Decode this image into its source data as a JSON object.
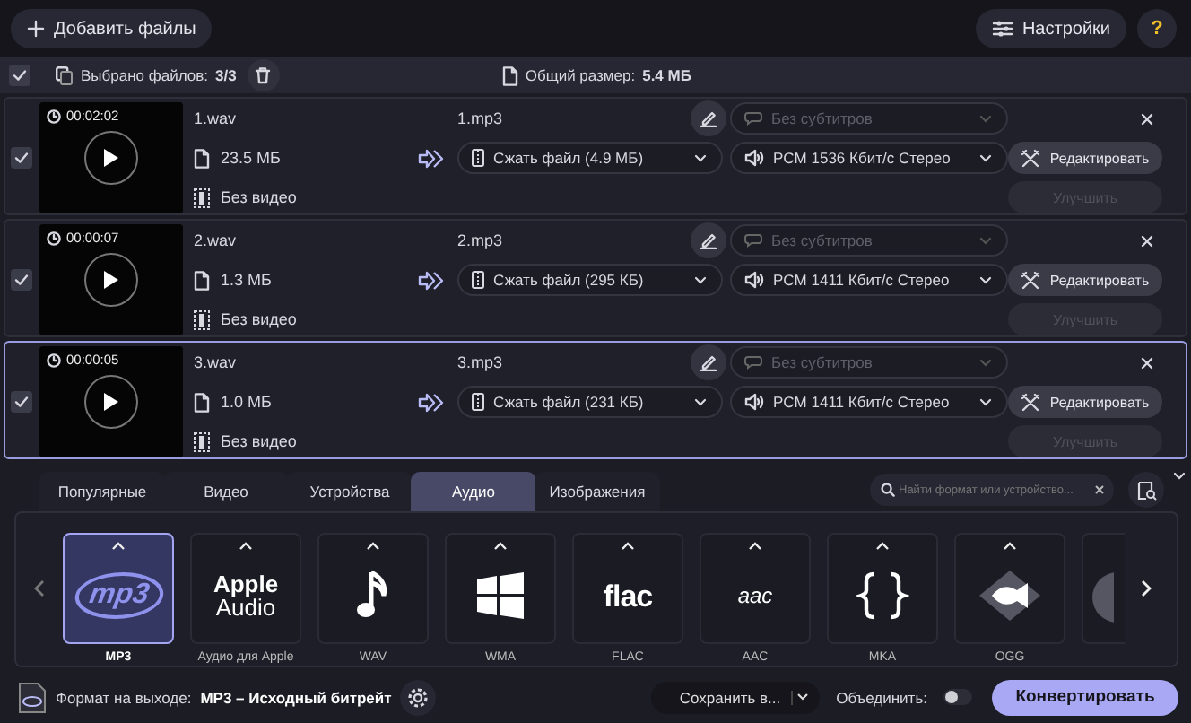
{
  "toolbar": {
    "add_button": "Добавить файлы",
    "settings_button": "Настройки",
    "help_button": "?"
  },
  "selection_bar": {
    "checked": true,
    "selected_label": "Выбрано файлов:",
    "selected_count": "3/3",
    "total_label": "Общий размер:",
    "total_value": "5.4 МБ"
  },
  "files": [
    {
      "checked": true,
      "selected": false,
      "duration": "00:02:02",
      "name": "1.wav",
      "size": "23.5 МБ",
      "video": "Без видео",
      "output_name": "1.mp3",
      "compress": "Сжать файл (4.9 МБ)",
      "subtitles": "Без субтитров",
      "subtitles_disabled": true,
      "audio": "PCM 1536 Кбит/с Стерео",
      "edit_button": "Редактировать",
      "enhance_button": "Улучшить",
      "enhance_disabled": true
    },
    {
      "checked": true,
      "selected": false,
      "duration": "00:00:07",
      "name": "2.wav",
      "size": "1.3 МБ",
      "video": "Без видео",
      "output_name": "2.mp3",
      "compress": "Сжать файл (295 КБ)",
      "subtitles": "Без субтитров",
      "subtitles_disabled": true,
      "audio": "PCM 1411 Кбит/с Стерео",
      "edit_button": "Редактировать",
      "enhance_button": "Улучшить",
      "enhance_disabled": true
    },
    {
      "checked": true,
      "selected": true,
      "duration": "00:00:05",
      "name": "3.wav",
      "size": "1.0 МБ",
      "video": "Без видео",
      "output_name": "3.mp3",
      "compress": "Сжать файл (231 КБ)",
      "subtitles": "Без субтитров",
      "subtitles_disabled": true,
      "audio": "PCM 1411 Кбит/с Стерео",
      "edit_button": "Редактировать",
      "enhance_button": "Улучшить",
      "enhance_disabled": true
    }
  ],
  "format_tabs": [
    {
      "label": "Популярные",
      "selected": false
    },
    {
      "label": "Видео",
      "selected": false
    },
    {
      "label": "Устройства",
      "selected": false
    },
    {
      "label": "Аудио",
      "selected": true
    },
    {
      "label": "Изображения",
      "selected": false
    }
  ],
  "search": {
    "placeholder": "Найти формат или устройство..."
  },
  "formats": [
    {
      "kind": "mp3",
      "logo": [
        "mp3"
      ],
      "label": "MP3",
      "selected": true
    },
    {
      "kind": "apple",
      "logo": [
        "Apple",
        "Audio"
      ],
      "label": "Аудио для Apple",
      "selected": false
    },
    {
      "kind": "note",
      "label": "WAV",
      "selected": false
    },
    {
      "kind": "windows",
      "label": "WMA",
      "selected": false
    },
    {
      "kind": "flac",
      "logo": [
        "flac"
      ],
      "label": "FLAC",
      "selected": false
    },
    {
      "kind": "aac",
      "logo": [
        "aac"
      ],
      "label": "AAC",
      "selected": false
    },
    {
      "kind": "braces",
      "label": "MKA",
      "selected": false
    },
    {
      "kind": "fish",
      "label": "OGG",
      "selected": false
    },
    {
      "kind": "disc",
      "selected": false
    }
  ],
  "footer": {
    "output_label": "Формат на выходе:",
    "output_value": "MP3 – Исходный битрейт",
    "save_button": "Сохранить в...",
    "merge_label": "Объединить:",
    "merge_on": false,
    "convert_button": "Конвертировать"
  }
}
